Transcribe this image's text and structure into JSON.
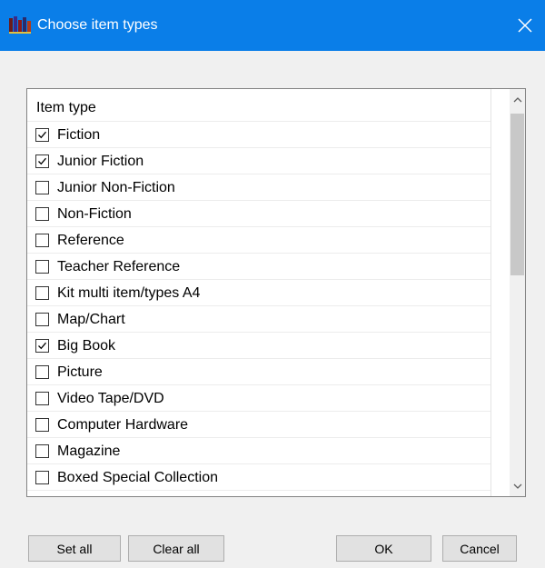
{
  "window": {
    "title": "Choose item types",
    "app_icon": "app-logo-icon",
    "close_icon": "close-icon"
  },
  "list": {
    "header": "Item type",
    "items": [
      {
        "label": "Fiction",
        "checked": true
      },
      {
        "label": "Junior Fiction",
        "checked": true
      },
      {
        "label": "Junior Non-Fiction",
        "checked": false
      },
      {
        "label": "Non-Fiction",
        "checked": false
      },
      {
        "label": "Reference",
        "checked": false
      },
      {
        "label": "Teacher Reference",
        "checked": false
      },
      {
        "label": "Kit multi item/types A4",
        "checked": false
      },
      {
        "label": "Map/Chart",
        "checked": false
      },
      {
        "label": "Big Book",
        "checked": true
      },
      {
        "label": "Picture",
        "checked": false
      },
      {
        "label": "Video Tape/DVD",
        "checked": false
      },
      {
        "label": "Computer Hardware",
        "checked": false
      },
      {
        "label": "Magazine",
        "checked": false
      },
      {
        "label": "Boxed Special Collection",
        "checked": false
      }
    ]
  },
  "buttons": {
    "set_all": "Set all",
    "clear_all": "Clear all",
    "ok": "OK",
    "cancel": "Cancel"
  },
  "colors": {
    "titlebar": "#0a7ee8",
    "background": "#f0f0f0",
    "button_face": "#e1e1e1"
  }
}
